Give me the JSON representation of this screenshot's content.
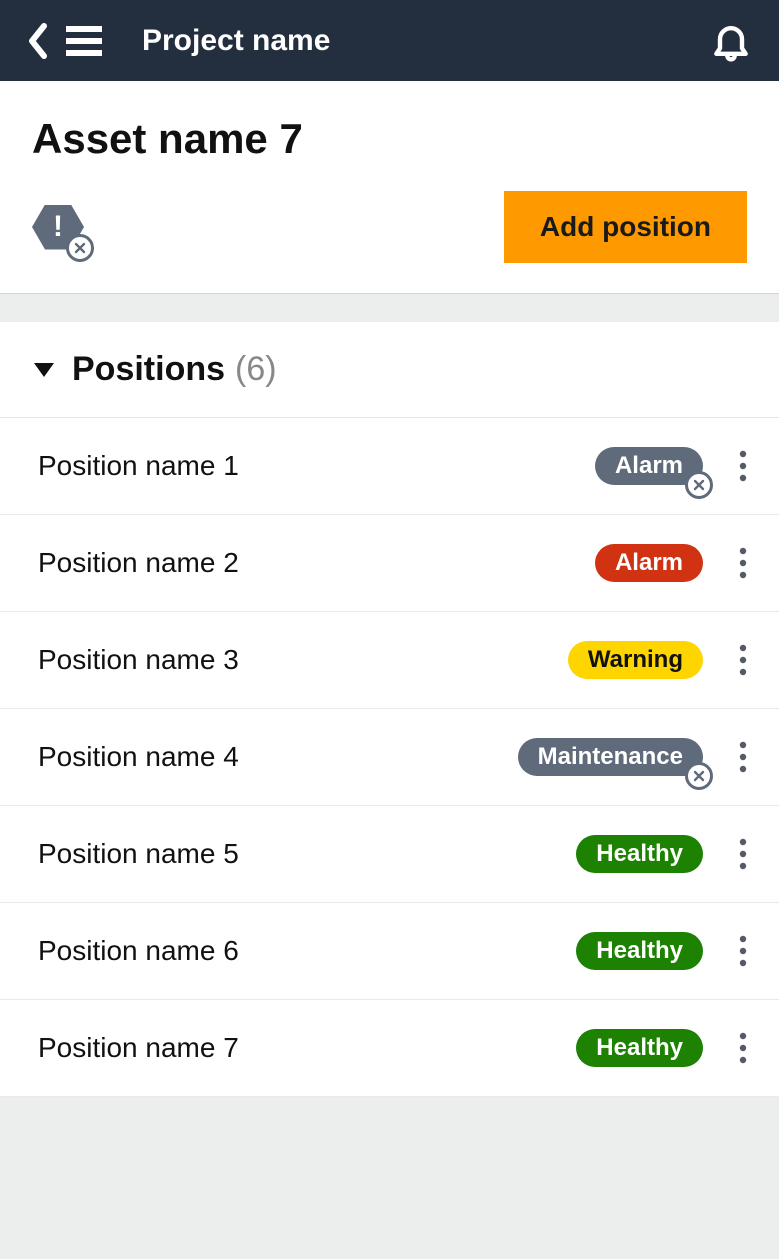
{
  "header": {
    "title": "Project name"
  },
  "asset": {
    "title": "Asset name 7",
    "add_button": "Add position"
  },
  "positions": {
    "section_label": "Positions",
    "count": "(6)",
    "items": [
      {
        "name": "Position name 1",
        "status": "Alarm",
        "style": "grey",
        "overlay": true
      },
      {
        "name": "Position name 2",
        "status": "Alarm",
        "style": "alarm",
        "overlay": false
      },
      {
        "name": "Position name 3",
        "status": "Warning",
        "style": "warning",
        "overlay": false
      },
      {
        "name": "Position name 4",
        "status": "Maintenance",
        "style": "maint",
        "overlay": true
      },
      {
        "name": "Position name 5",
        "status": "Healthy",
        "style": "healthy",
        "overlay": false
      },
      {
        "name": "Position name 6",
        "status": "Healthy",
        "style": "healthy",
        "overlay": false
      },
      {
        "name": "Position name 7",
        "status": "Healthy",
        "style": "healthy",
        "overlay": false
      }
    ]
  }
}
